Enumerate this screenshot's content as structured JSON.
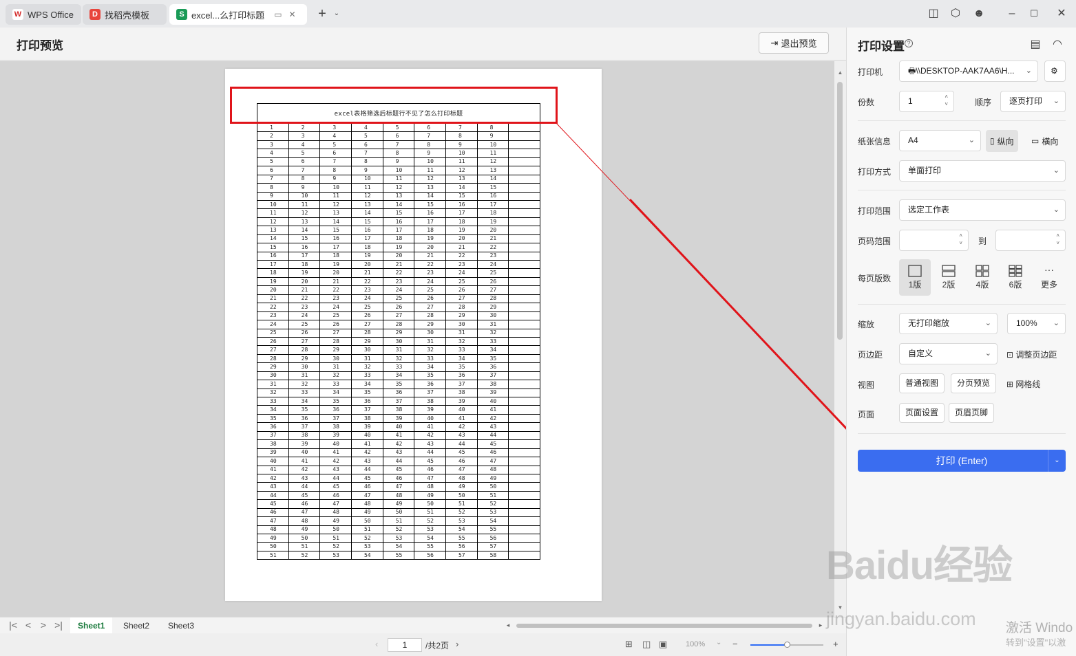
{
  "tabs": [
    {
      "label": "WPS Office",
      "icon": "wps-logo-icon"
    },
    {
      "label": "找稻壳模板",
      "icon": "docer-logo-icon"
    },
    {
      "label": "excel...么打印标题",
      "icon": "spreadsheet-s-icon"
    }
  ],
  "header": {
    "title": "打印预览",
    "exit_label": "退出预览"
  },
  "sheet": {
    "title": "excel表格筛选后标题行不见了怎么打印标题",
    "row_start": 1,
    "row_end": 51,
    "column_count": 9,
    "filled_columns": 8
  },
  "sheet_tabs": [
    "Sheet1",
    "Sheet2",
    "Sheet3"
  ],
  "status": {
    "page": "1",
    "total": "/共2页",
    "zoom": "100%"
  },
  "settings": {
    "title": "打印设置",
    "printer_label": "打印机",
    "printer_value": "\\\\DESKTOP-AAK7AA6\\H...",
    "copies_label": "份数",
    "copies_value": "1",
    "order_label": "顺序",
    "order_value": "逐页打印",
    "paper_label": "纸张信息",
    "paper_value": "A4",
    "portrait": "纵向",
    "landscape": "横向",
    "mode_label": "打印方式",
    "mode_value": "单面打印",
    "range_label": "打印范围",
    "range_value": "选定工作表",
    "pages_label": "页码范围",
    "to_label": "到",
    "per_page_label": "每页版数",
    "per_page_options": [
      "1版",
      "2版",
      "4版",
      "6版",
      "更多"
    ],
    "scale_label": "缩放",
    "scale_value": "无打印缩放",
    "scale_pct": "100%",
    "margin_label": "页边距",
    "margin_value": "自定义",
    "adjust_margin": "调整页边距",
    "view_label": "视图",
    "normal_view": "普通视图",
    "page_break_preview": "分页预览",
    "gridlines": "网格线",
    "page_label": "页面",
    "page_setup": "页面设置",
    "header_footer": "页眉页脚",
    "print_button": "打印 (Enter)"
  },
  "watermark": {
    "baidu": "Baidu经验",
    "url": "jingyan.baidu.com",
    "activate": "激活 Windo",
    "activate_sub": "转到\"设置\"以激"
  }
}
